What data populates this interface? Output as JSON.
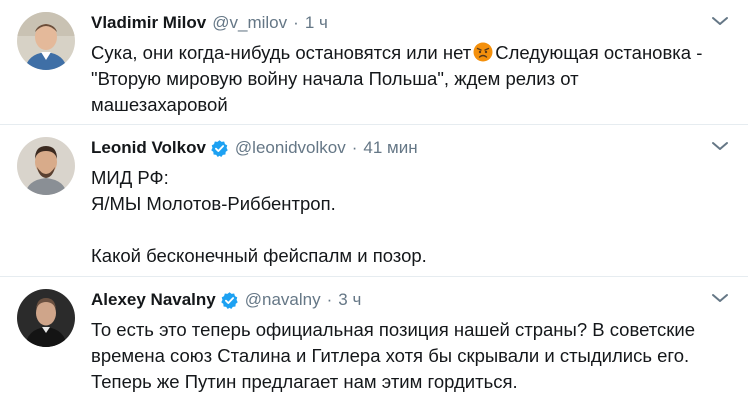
{
  "tweets": [
    {
      "author": "Vladimir Milov",
      "handle": "@v_milov",
      "separator": "·",
      "time": "1 ч",
      "verified": false,
      "lines": [
        "Сука, они когда-нибудь остановятся или нет",
        "Следующая остановка -",
        "\"Вторую мировую войну начала Польша\", ждем релиз от",
        "машезахаровой"
      ]
    },
    {
      "author": "Leonid Volkov",
      "handle": "@leonidvolkov",
      "separator": "·",
      "time": "41 мин",
      "verified": true,
      "lines": [
        "МИД РФ:",
        "Я/МЫ Молотов-Риббентроп.",
        "Какой бесконечный фейспалм и позор."
      ]
    },
    {
      "author": "Alexey Navalny",
      "handle": "@navalny",
      "separator": "·",
      "time": "3 ч",
      "verified": true,
      "lines": [
        "То есть это теперь официальная позиция нашей страны? В советские",
        "времена союз Сталина и Гитлера хотя бы скрывали и стыдились его.",
        "Теперь же Путин предлагает нам этим гордиться."
      ]
    }
  ],
  "colors": {
    "text": "#14171a",
    "secondary": "#657786",
    "verified": "#1da1f2",
    "divider": "#e6ecf0"
  },
  "icons": {
    "verified": "verified-badge-icon",
    "caret": "chevron-down-icon",
    "emoji": "angry-face-emoji-icon"
  }
}
